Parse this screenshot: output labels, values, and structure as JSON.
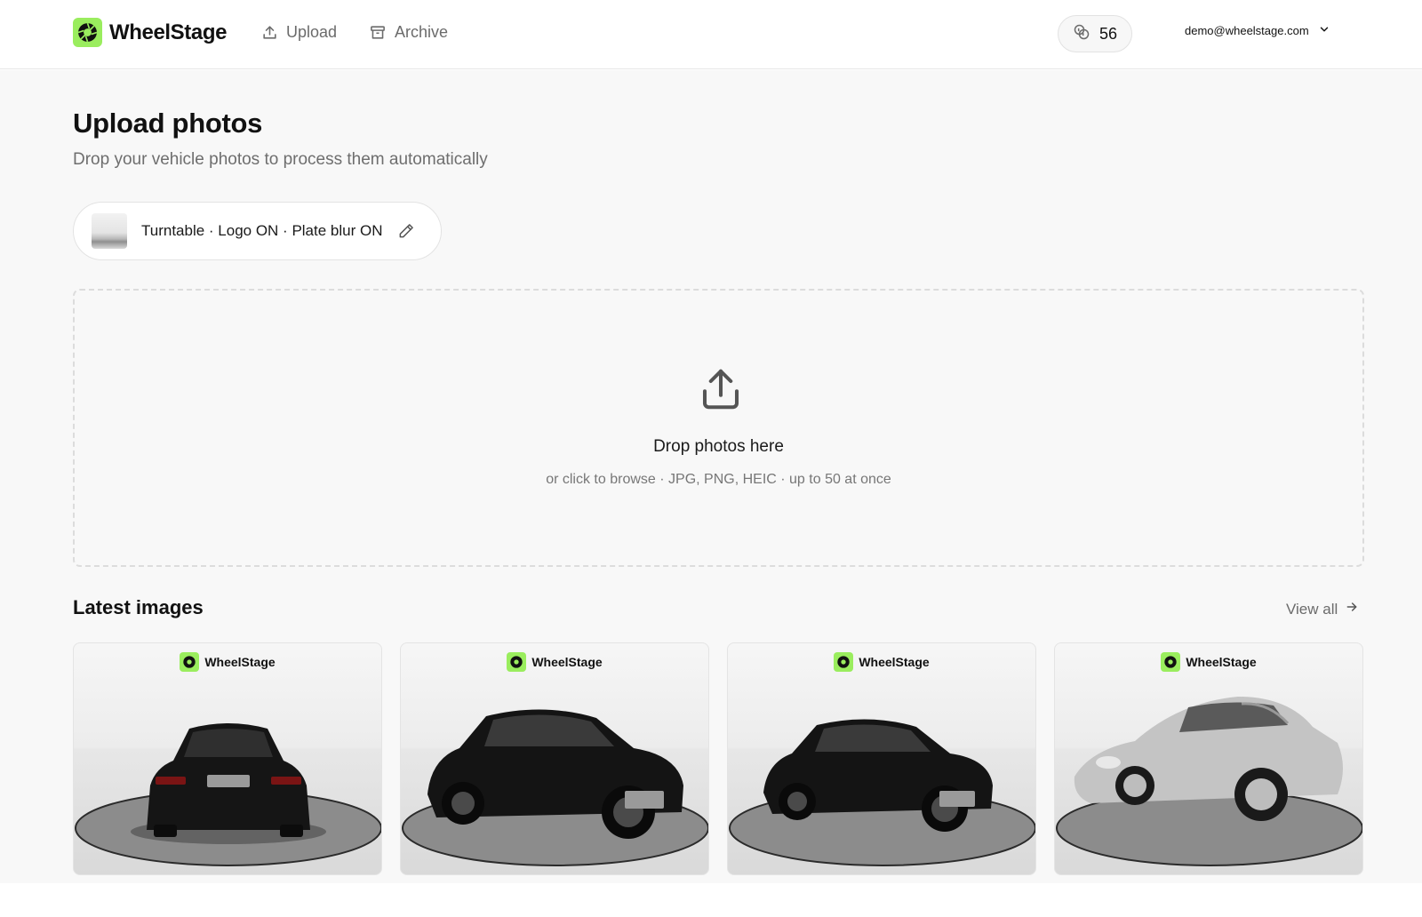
{
  "app": {
    "brand": "WheelStage",
    "colors": {
      "brand_green": "#9aed5e",
      "text": "#111111",
      "muted": "#6e6e6e",
      "page_bg": "#f8f8f8"
    }
  },
  "nav": {
    "items": [
      {
        "label": "Upload",
        "icon": "upload-icon"
      },
      {
        "label": "Archive",
        "icon": "archive-icon"
      }
    ]
  },
  "header": {
    "credits": "56",
    "credits_icon": "coins-icon",
    "account_email": "demo@wheelstage.com",
    "account_icon": "chevron-down-icon"
  },
  "page": {
    "title": "Upload photos",
    "subtitle": "Drop your vehicle photos to process them automatically"
  },
  "preset": {
    "label": "Turntable · Logo ON · Plate blur ON",
    "edit_icon": "pencil-icon"
  },
  "dropzone": {
    "icon": "upload-tray-icon",
    "title": "Drop photos here",
    "hint": "or click to browse · JPG, PNG, HEIC · up to 50 at once"
  },
  "latest": {
    "title": "Latest images",
    "view_all": "View all",
    "view_all_icon": "arrow-right-icon",
    "images": [
      {
        "watermark": "WheelStage",
        "car": "black sedan, rear view",
        "tone": "black"
      },
      {
        "watermark": "WheelStage",
        "car": "black sedan, front three-quarter view",
        "tone": "black"
      },
      {
        "watermark": "WheelStage",
        "car": "black sedan, front three-quarter view",
        "tone": "black"
      },
      {
        "watermark": "WheelStage",
        "car": "silver sports coupe, front three-quarter view",
        "tone": "silver"
      }
    ]
  }
}
